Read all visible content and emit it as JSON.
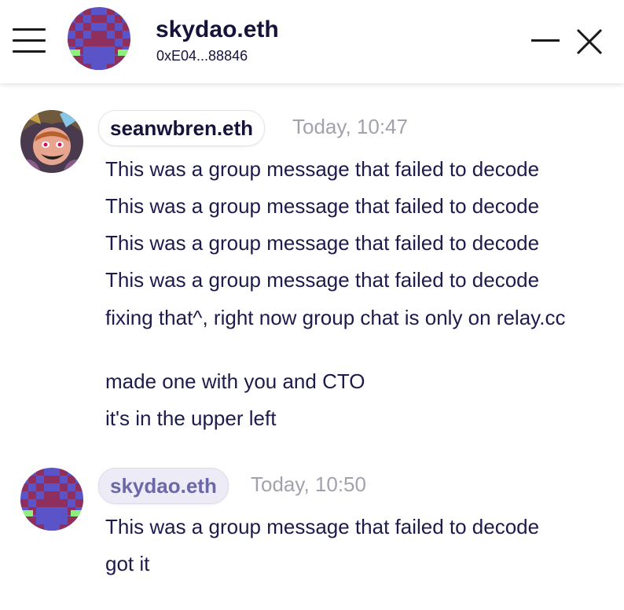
{
  "header": {
    "title": "skydao.eth",
    "address": "0xE04...88846"
  },
  "groups": [
    {
      "sender": "seanwbren.eth",
      "time": "Today, 10:47",
      "messages": [
        "This was a group message that failed to decode",
        "This was a group message that failed to decode",
        "This was a group message that failed to decode",
        "This was a group message that failed to decode",
        "fixing that^, right now group chat is only on relay.cc",
        "made one with you and CTO",
        "it's in the upper left"
      ]
    },
    {
      "sender": "skydao.eth",
      "time": "Today, 10:50",
      "messages": [
        "This was a group message that failed to decode",
        "got it"
      ]
    }
  ],
  "colors": {
    "text": "#1d1b4b",
    "timestamp": "#a2a2ad",
    "self_pill_bg": "#ecebf6",
    "self_pill_text": "#6b68a8",
    "identicon_purple": "#5b54c9",
    "identicon_maroon": "#8e2f5e",
    "identicon_green": "#8ef07c"
  },
  "icons": [
    "menu-icon",
    "minimize-icon",
    "close-icon"
  ]
}
